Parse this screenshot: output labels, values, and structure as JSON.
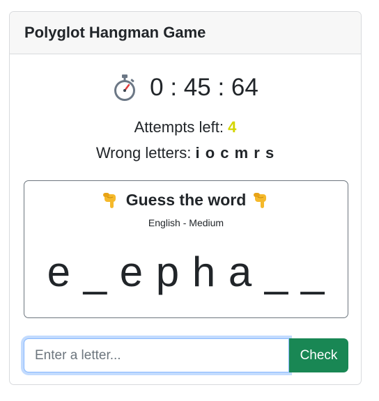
{
  "header": {
    "title": "Polyglot Hangman Game"
  },
  "timer": {
    "icon": "stopwatch-icon",
    "text": "0 : 45 : 64"
  },
  "attempts": {
    "label": "Attempts left: ",
    "count": "4",
    "count_color": "#d4d500"
  },
  "wrong_letters": {
    "label": "Wrong letters: ",
    "letters": "i o c m r s"
  },
  "puzzle": {
    "title": "Guess the word",
    "icon": "pointing-down-hand-icon",
    "language_level": "English - Medium",
    "masked_word": "e _ e p h a _ _"
  },
  "input": {
    "placeholder": "Enter a letter...",
    "value": ""
  },
  "check_button": {
    "label": "Check",
    "color": "#198754"
  }
}
